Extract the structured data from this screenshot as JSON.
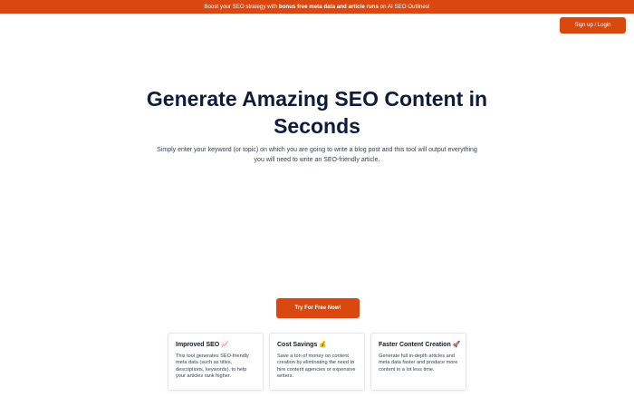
{
  "banner": {
    "prefix": "Boost your SEO strategy with ",
    "bold": "bonus free meta data and article runs",
    "suffix": " on AI SEO Outlines!"
  },
  "header": {
    "auth_label": "Sign up / Login"
  },
  "hero": {
    "title": "Generate Amazing SEO Content in Seconds",
    "subtitle": "Simply enter your keyword (or topic) on which you are going to write a blog post and this tool will output everything you will need to write an SEO-friendly article."
  },
  "cta": {
    "label": "Try For Free Now!"
  },
  "features": [
    {
      "title": "Improved SEO",
      "emoji": "📈",
      "text": "This tool generates SEO-friendly meta data (such as titles, descriptions, keywords), to help your articles rank higher."
    },
    {
      "title": "Cost Savings",
      "emoji": "💰",
      "text": "Save a ton of money on content creation by eliminating the need to hire content agencies or expensive writers."
    },
    {
      "title": "Faster Content Creation",
      "emoji": "🚀",
      "text": "Generate full in-depth articles and meta data faster and produce more content in a lot less time."
    }
  ],
  "colors": {
    "accent": "#d9480f",
    "title": "#0f1b3d"
  }
}
